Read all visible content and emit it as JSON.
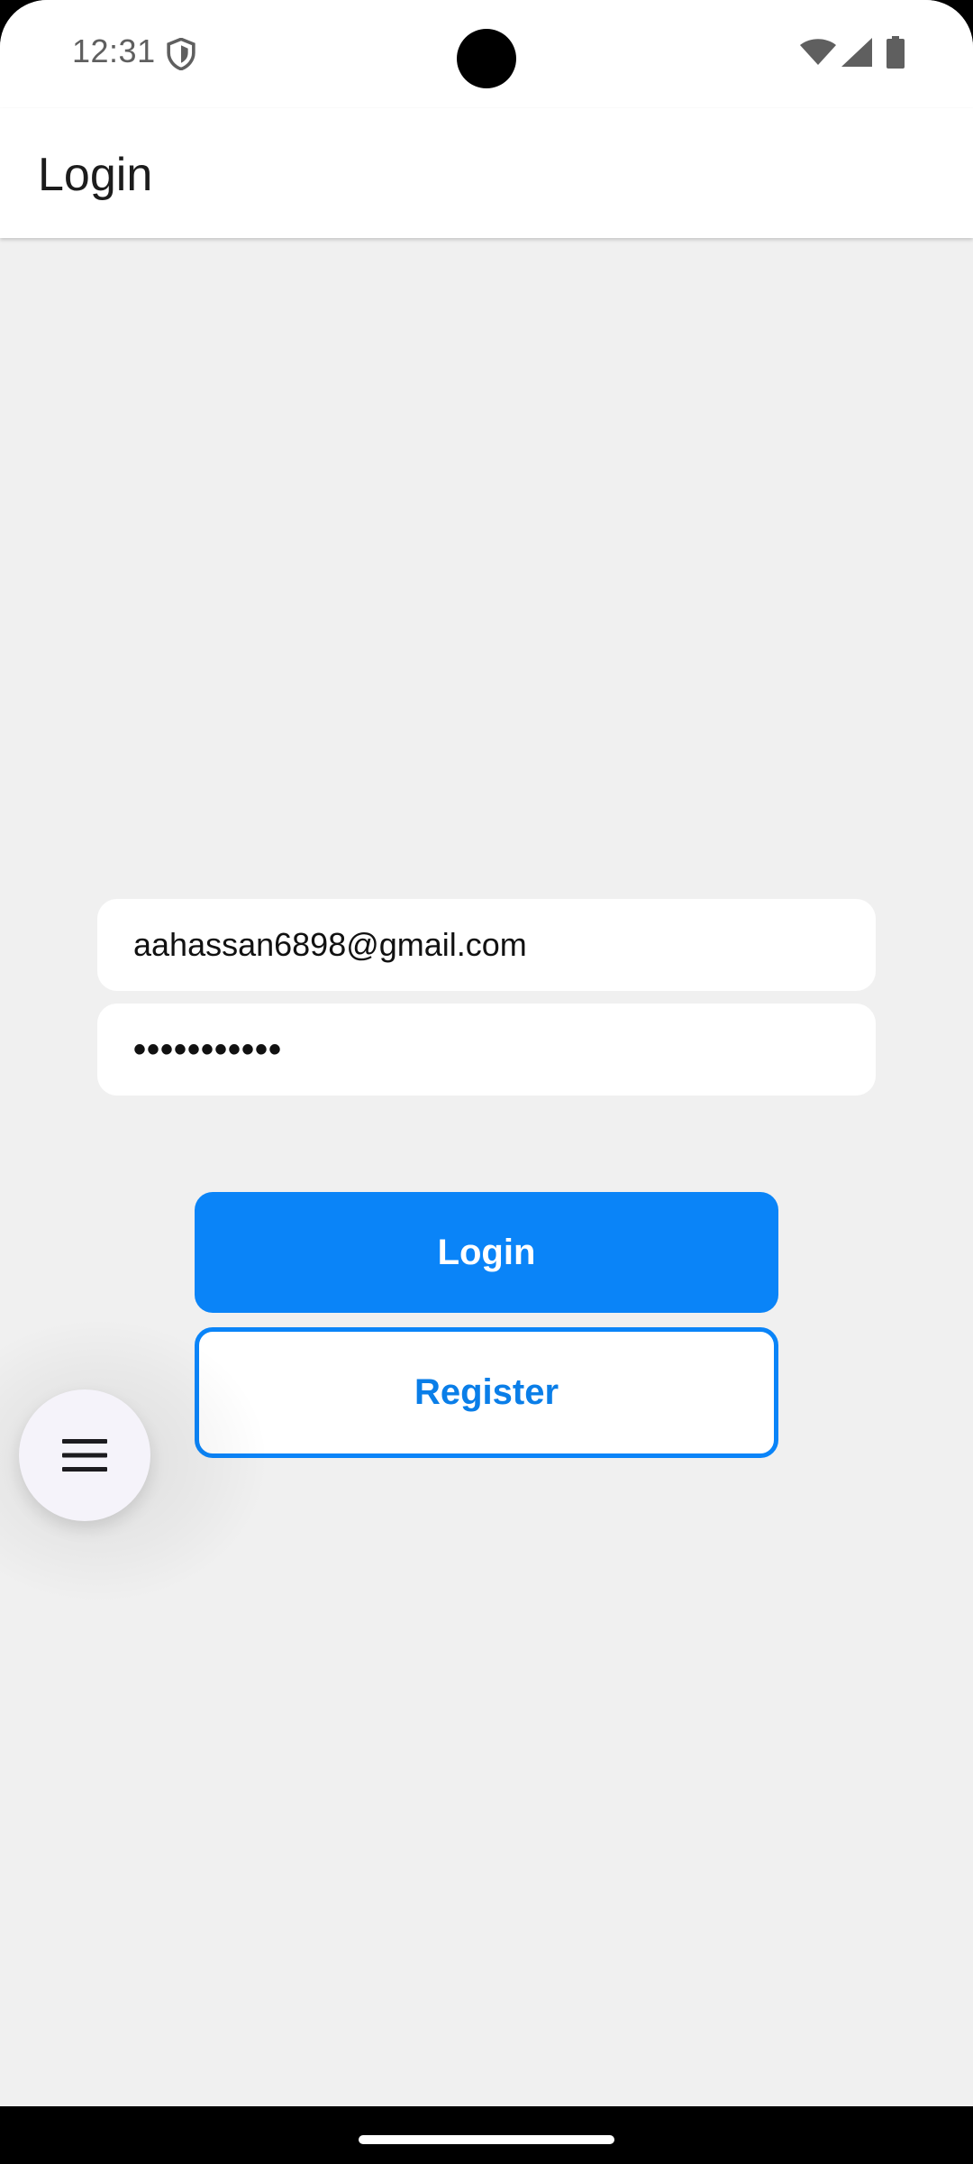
{
  "status_bar": {
    "time": "12:31",
    "icons": [
      "shield-icon",
      "wifi-icon",
      "signal-icon",
      "battery-icon"
    ]
  },
  "app_bar": {
    "title": "Login"
  },
  "form": {
    "email_value": "aahassan6898@gmail.com",
    "password_value": "•••••••••••"
  },
  "buttons": {
    "login_label": "Login",
    "register_label": "Register"
  },
  "fab": {
    "icon": "menu-icon"
  },
  "colors": {
    "accent": "#0a84f8",
    "background": "#f0f0f0",
    "surface": "#ffffff"
  }
}
